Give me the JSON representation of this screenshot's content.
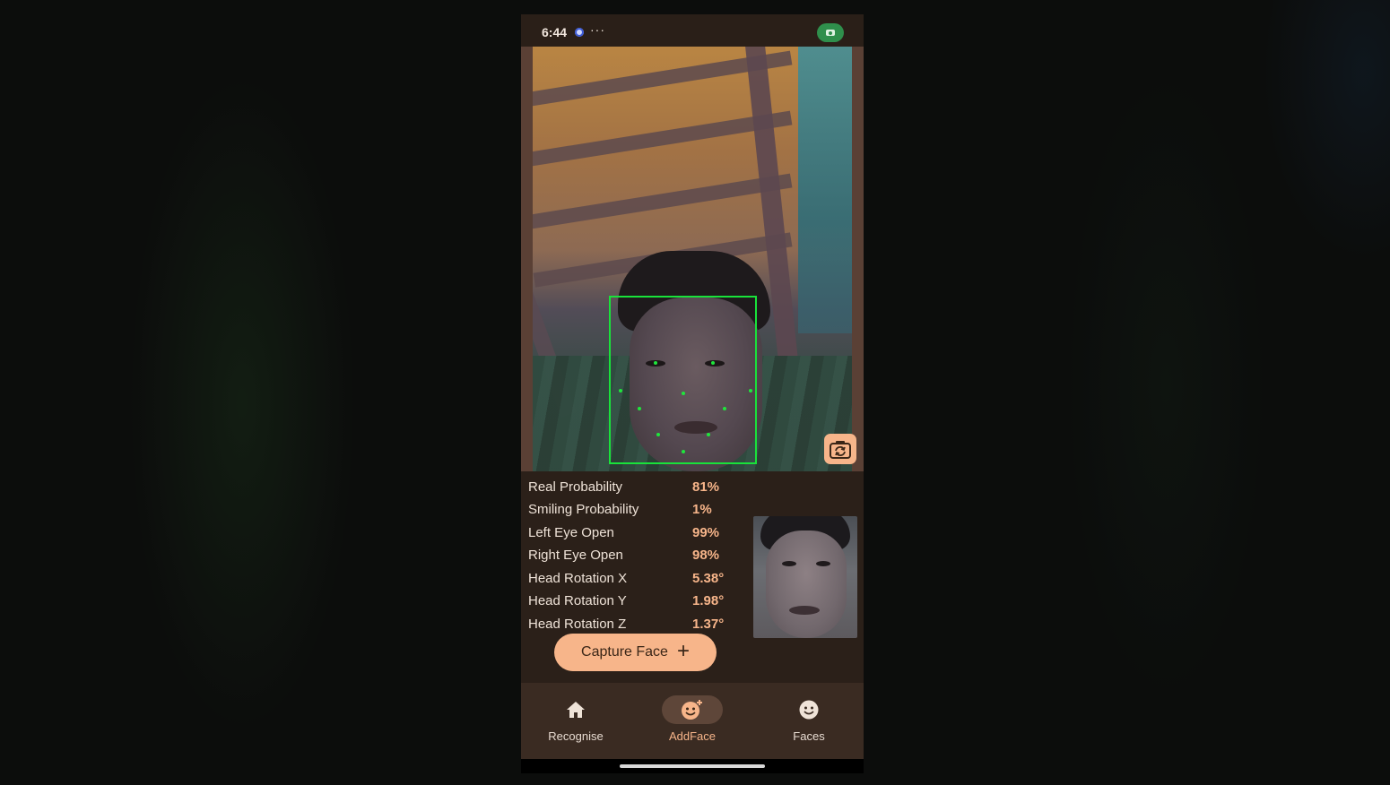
{
  "status_bar": {
    "time": "6:44",
    "dots": "···"
  },
  "stats": [
    {
      "label": "Real Probability",
      "value": "81%"
    },
    {
      "label": "Smiling Probability",
      "value": "1%"
    },
    {
      "label": "Left Eye Open",
      "value": "99%"
    },
    {
      "label": "Right Eye Open",
      "value": "98%"
    },
    {
      "label": "Head Rotation X",
      "value": "5.38°"
    },
    {
      "label": "Head Rotation Y",
      "value": "1.98°"
    },
    {
      "label": "Head Rotation Z",
      "value": "1.37°"
    }
  ],
  "capture_button": {
    "label": "Capture Face",
    "icon": "plus-icon"
  },
  "nav": {
    "items": [
      {
        "label": "Recognise",
        "icon": "home-icon",
        "active": false
      },
      {
        "label": "AddFace",
        "icon": "add-face-icon",
        "active": true
      },
      {
        "label": "Faces",
        "icon": "face-icon",
        "active": false
      }
    ]
  },
  "colors": {
    "accent": "#f7b58a",
    "face_box": "#19e23a",
    "background": "#2b2019",
    "nav_background": "#3a2b22",
    "status_pill": "#2f8f4c"
  },
  "icons": {
    "switch_camera": "switch-camera-icon",
    "status_chat": "chat-bubble-icon",
    "status_camera": "camera-icon"
  }
}
